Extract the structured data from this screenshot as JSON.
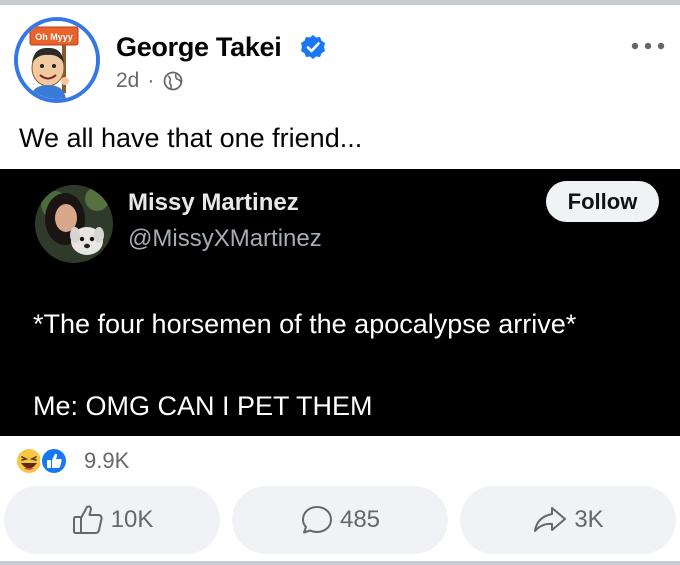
{
  "post": {
    "author": "George Takei",
    "time": "2d",
    "separator": "·",
    "avatar_sign": "Oh Myyy",
    "caption": "We all have that one friend..."
  },
  "tweet": {
    "name": "Missy Martinez",
    "handle": "@MissyXMartinez",
    "follow_label": "Follow",
    "line1": "*The four horsemen of the apocalypse arrive*",
    "line2": "Me: OMG CAN I PET THEM"
  },
  "reactions": {
    "icons": [
      "haha-icon",
      "like-icon"
    ],
    "count": "9.9K"
  },
  "actions": {
    "like_count": "10K",
    "comment_count": "485",
    "share_count": "3K"
  },
  "colors": {
    "accent": "#1877f2",
    "secondary_text": "#65676b",
    "button_bg": "#f0f2f5",
    "tweet_bg": "#000000"
  }
}
